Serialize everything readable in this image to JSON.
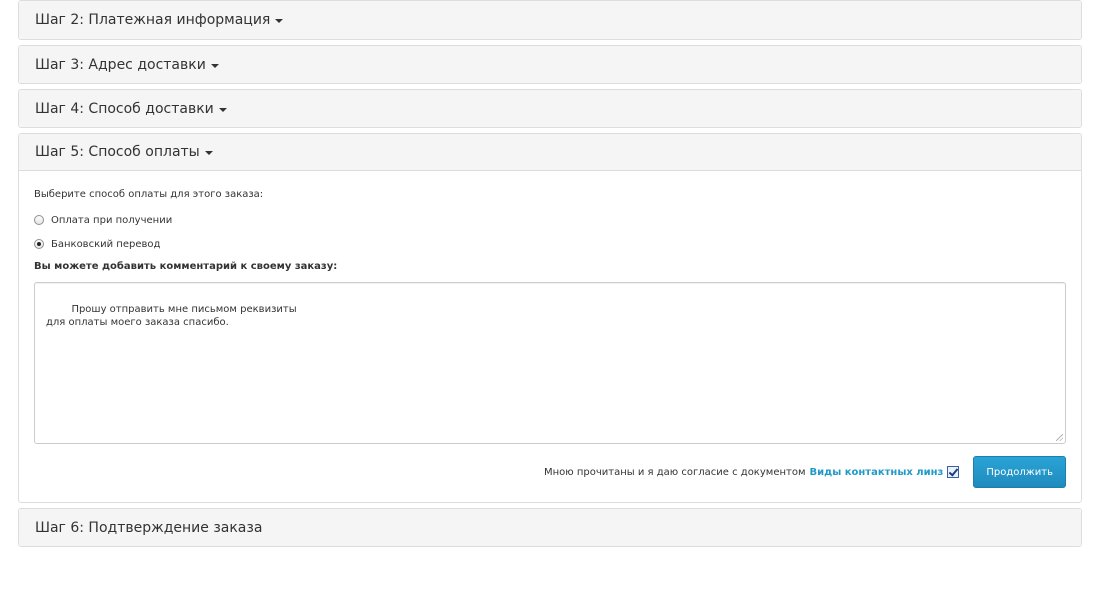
{
  "steps": [
    {
      "label": "Шаг 2: Платежная информация",
      "caret": true
    },
    {
      "label": "Шаг 3: Адрес доставки",
      "caret": true
    },
    {
      "label": "Шаг 4: Способ доставки",
      "caret": true
    },
    {
      "label": "Шаг 5: Способ оплаты",
      "caret": true
    },
    {
      "label": "Шаг 6: Подтверждение заказа",
      "caret": false
    }
  ],
  "payment": {
    "intro": "Выберите способ оплаты для этого заказа:",
    "options": [
      {
        "label": "Оплата при получении",
        "checked": false
      },
      {
        "label": "Банковский перевод",
        "checked": true
      }
    ],
    "comment_label": "Вы можете добавить комментарий к своему заказу:",
    "comment_value": "Прошу отправить мне письмом реквизиты\nдля оплаты моего заказа спасибо.",
    "agree_text": "Мною прочитаны и я даю согласие с документом",
    "agree_link": "Виды контактных линз",
    "agree_checked": true,
    "continue_label": "Продолжить"
  },
  "colors": {
    "link": "#229ac8",
    "button": "#229ac8",
    "panel_heading_bg": "#f5f5f5",
    "border": "#dddddd"
  }
}
